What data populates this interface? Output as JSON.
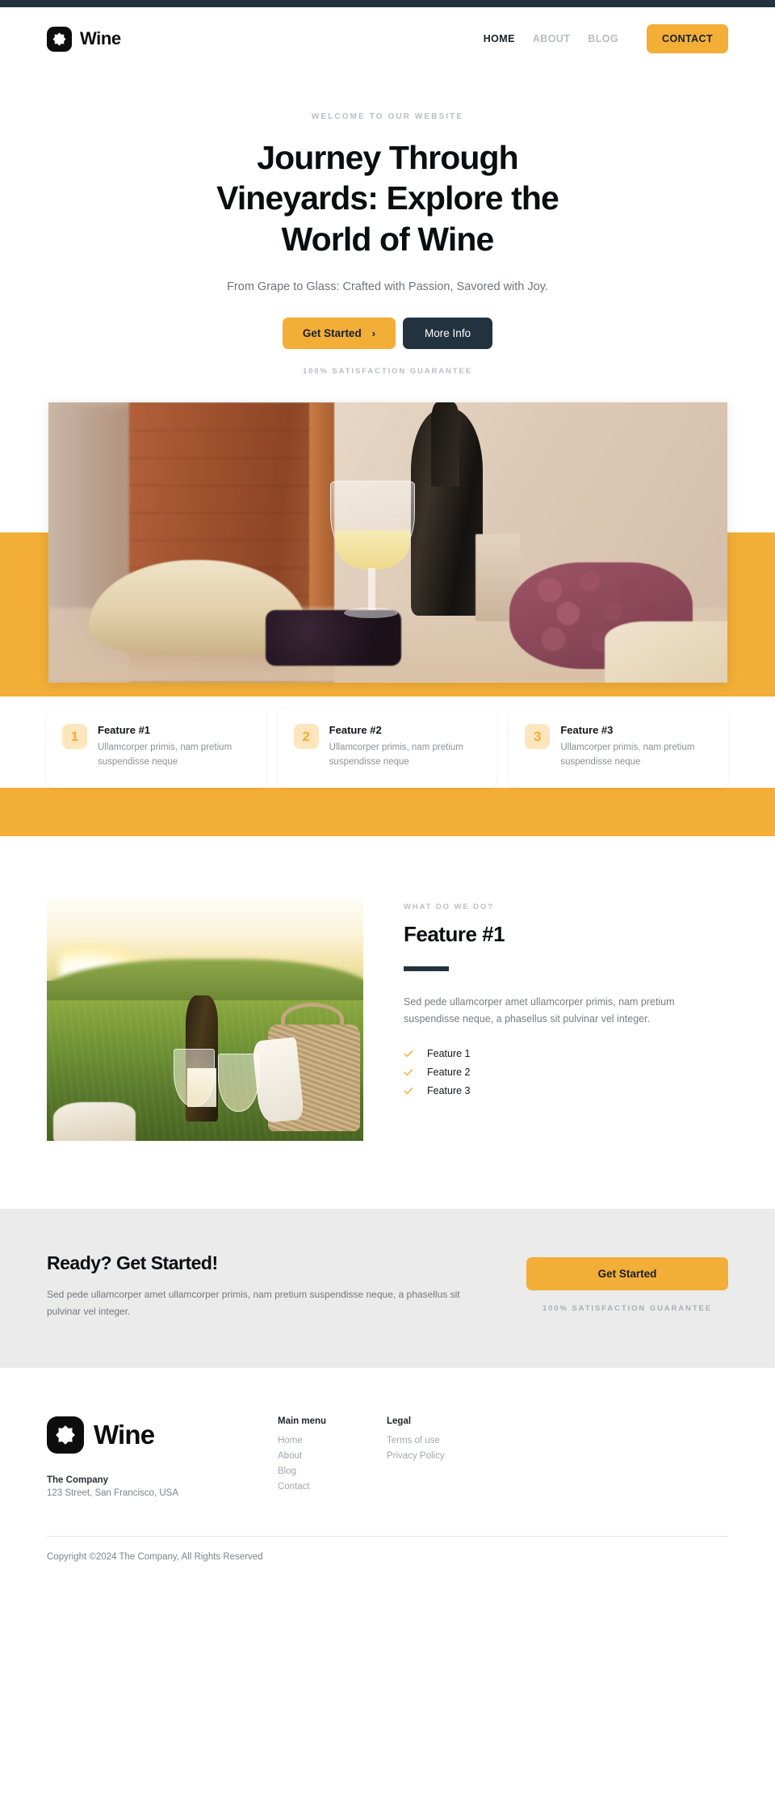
{
  "theme": {
    "accent": "#f2ae36",
    "dark": "#22333f",
    "badge_bg": "#fde6bd",
    "cta_bg": "#ebebeb"
  },
  "header": {
    "brand": "Wine",
    "logo_icon": "wine-logo-icon",
    "nav": [
      {
        "label": "HOME",
        "active": true
      },
      {
        "label": "ABOUT",
        "active": false
      },
      {
        "label": "BLOG",
        "active": false
      }
    ],
    "contact_label": "CONTACT"
  },
  "hero": {
    "eyebrow": "WELCOME TO OUR WEBSITE",
    "headline": "Journey Through Vineyards: Explore the World of Wine",
    "subtitle": "From Grape to Glass: Crafted with Passion, Savored with Joy.",
    "primary_button": "Get Started",
    "primary_button_icon": "chevron-right-icon",
    "secondary_button": "More Info",
    "guarantee": "100% SATISFACTION GUARANTEE",
    "image_alt": "wine bottle, glass of white wine, grapes and straw hat on a table"
  },
  "features": {
    "cards": [
      {
        "number": "1",
        "title": "Feature #1",
        "text": "Ullamcorper primis, nam pretium suspendisse neque"
      },
      {
        "number": "2",
        "title": "Feature #2",
        "text": "Ullamcorper primis, nam pretium suspendisse neque"
      },
      {
        "number": "3",
        "title": "Feature #3",
        "text": "Ullamcorper primis, nam pretium suspendisse neque"
      }
    ]
  },
  "what_we_do": {
    "eyebrow": "WHAT DO WE DO?",
    "title": "Feature #1",
    "text": "Sed pede ullamcorper amet ullamcorper primis, nam pretium suspendisse neque, a phasellus sit pulvinar vel integer.",
    "image_alt": "bottle of white wine, two glasses and a picnic basket in a sunlit meadow",
    "list": [
      {
        "label": "Feature 1",
        "icon": "check-icon"
      },
      {
        "label": "Feature 2",
        "icon": "check-icon"
      },
      {
        "label": "Feature 3",
        "icon": "check-icon"
      }
    ]
  },
  "cta": {
    "title": "Ready? Get Started!",
    "text": "Sed pede ullamcorper amet ullamcorper primis, nam pretium suspendisse neque, a phasellus sit pulvinar vel integer.",
    "button": "Get Started",
    "guarantee": "100% SATISFACTION GUARANTEE"
  },
  "footer": {
    "brand": "Wine",
    "company": "The Company",
    "address": "123 Street, San Francisco, USA",
    "columns": [
      {
        "title": "Main menu",
        "links": [
          "Home",
          "About",
          "Blog",
          "Contact"
        ]
      },
      {
        "title": "Legal",
        "links": [
          "Terms of use",
          "Privacy Policy"
        ]
      }
    ],
    "copyright": "Copyright ©2024 The Company, All Rights Reserved"
  }
}
